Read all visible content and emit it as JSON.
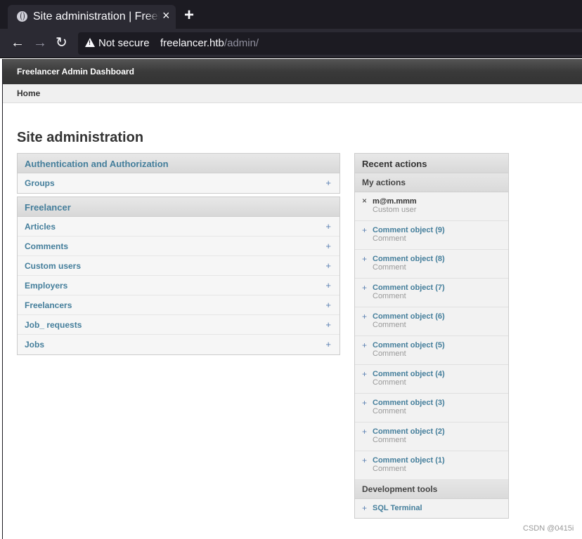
{
  "browser": {
    "tab_title": "Site administration | Freelancer",
    "tab_close": "×",
    "new_tab": "+",
    "back": "←",
    "forward": "→",
    "reload": "↻",
    "security_label": "Not secure",
    "url_host": "freelancer.htb",
    "url_path": "/admin/"
  },
  "header": {
    "brand": "Freelancer Admin Dashboard"
  },
  "breadcrumbs": {
    "home": "Home"
  },
  "page_title": "Site administration",
  "apps": [
    {
      "caption": "Authentication and Authorization",
      "models": [
        {
          "label": "Groups",
          "add": "+"
        }
      ]
    },
    {
      "caption": "Freelancer",
      "models": [
        {
          "label": "Articles",
          "add": "+"
        },
        {
          "label": "Comments",
          "add": "+"
        },
        {
          "label": "Custom users",
          "add": "+"
        },
        {
          "label": "Employers",
          "add": "+"
        },
        {
          "label": "Freelancers",
          "add": "+"
        },
        {
          "label": "Job_ requests",
          "add": "+"
        },
        {
          "label": "Jobs",
          "add": "+"
        }
      ]
    }
  ],
  "recent": {
    "caption": "Recent actions",
    "my_actions": "My actions",
    "actions": [
      {
        "mark": "×",
        "name": "m@m.mmm",
        "type": "Custom user"
      },
      {
        "mark": "+",
        "name": "Comment object (9)",
        "type": "Comment"
      },
      {
        "mark": "+",
        "name": "Comment object (8)",
        "type": "Comment"
      },
      {
        "mark": "+",
        "name": "Comment object (7)",
        "type": "Comment"
      },
      {
        "mark": "+",
        "name": "Comment object (6)",
        "type": "Comment"
      },
      {
        "mark": "+",
        "name": "Comment object (5)",
        "type": "Comment"
      },
      {
        "mark": "+",
        "name": "Comment object (4)",
        "type": "Comment"
      },
      {
        "mark": "+",
        "name": "Comment object (3)",
        "type": "Comment"
      },
      {
        "mark": "+",
        "name": "Comment object (2)",
        "type": "Comment"
      },
      {
        "mark": "+",
        "name": "Comment object (1)",
        "type": "Comment"
      }
    ],
    "dev_tools": "Development tools",
    "sql_mark": "+",
    "sql_terminal": "SQL Terminal"
  },
  "watermark": "CSDN @0415i"
}
